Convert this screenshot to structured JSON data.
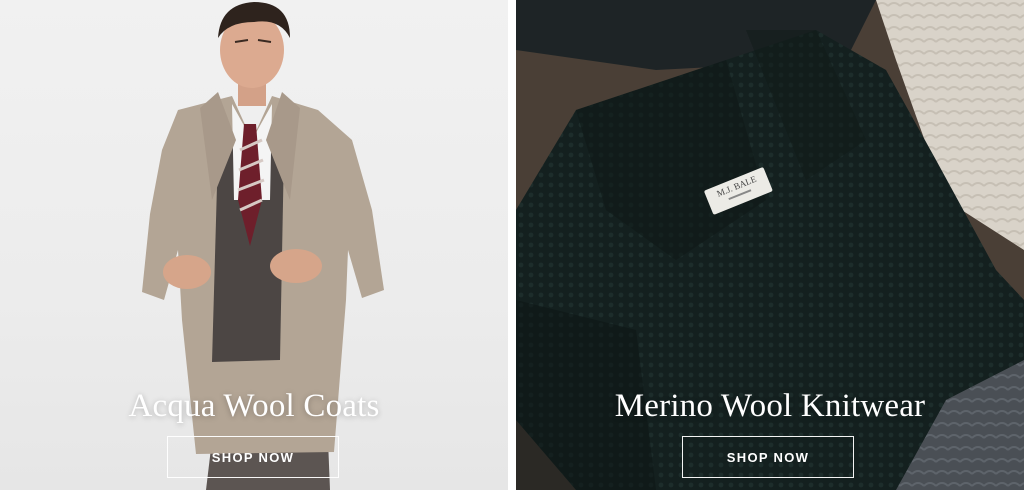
{
  "tiles": [
    {
      "title": "Acqua Wool Coats",
      "cta": "SHOP NOW",
      "image": "model-in-camel-overcoat-photo"
    },
    {
      "title": "Merino Wool Knitwear",
      "cta": "SHOP NOW",
      "image": "folded-knit-cardigans-photo",
      "label_text": "M.J. BALE"
    }
  ],
  "colors": {
    "caption": "#ffffff",
    "coat": "#b3a595",
    "knit_dark": "#14201f",
    "knit_grey": "#4a4f55",
    "knit_cream": "#d9d3c9"
  }
}
